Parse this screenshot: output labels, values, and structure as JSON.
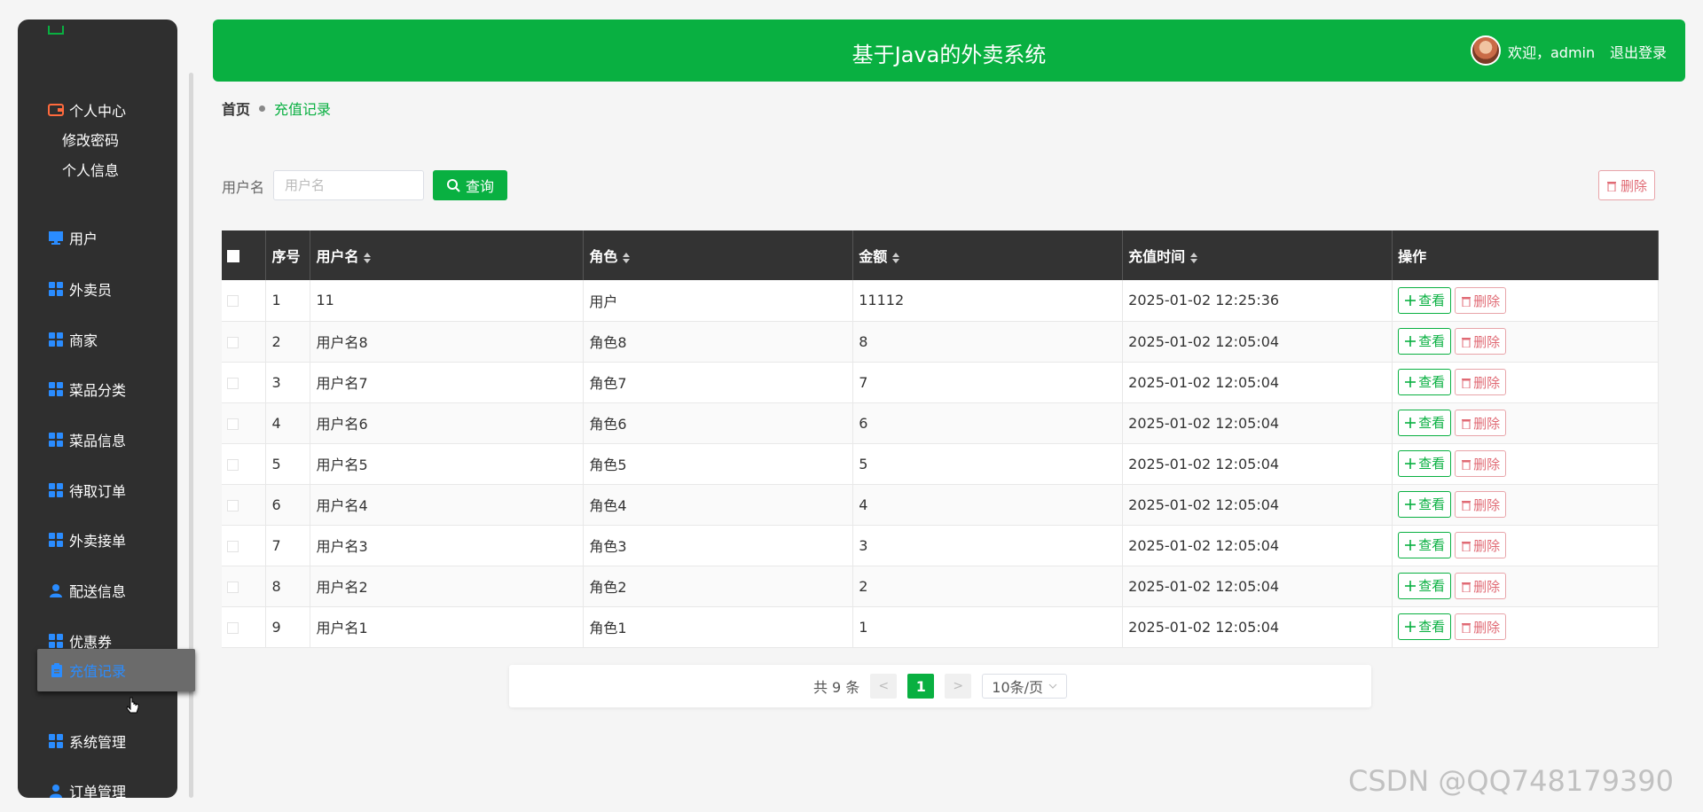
{
  "sidebar": {
    "cut_label": "",
    "personal_center": "个人中心",
    "sub_items": [
      "修改密码",
      "个人信息"
    ],
    "items": [
      {
        "label": "用户",
        "icon": "monitor-icon"
      },
      {
        "label": "外卖员",
        "icon": "grid-icon"
      },
      {
        "label": "商家",
        "icon": "grid-icon"
      },
      {
        "label": "菜品分类",
        "icon": "grid-icon"
      },
      {
        "label": "菜品信息",
        "icon": "grid-icon"
      },
      {
        "label": "待取订单",
        "icon": "grid-icon"
      },
      {
        "label": "外卖接单",
        "icon": "grid-icon"
      },
      {
        "label": "配送信息",
        "icon": "user-icon"
      },
      {
        "label": "优惠券",
        "icon": "grid-icon"
      },
      {
        "label": "充值记录",
        "icon": "clipboard-icon"
      },
      {
        "label": "系统管理",
        "icon": "grid-icon"
      },
      {
        "label": "订单管理",
        "icon": "user-icon"
      }
    ]
  },
  "header": {
    "title": "基于Java的外卖系统",
    "welcome": "欢迎，admin",
    "logout": "退出登录"
  },
  "breadcrumb": {
    "home": "首页",
    "current": "充值记录"
  },
  "search": {
    "label": "用户名",
    "placeholder": "用户名",
    "query_label": "查询",
    "delete_label": "删除"
  },
  "table": {
    "columns": [
      "序号",
      "用户名",
      "角色",
      "金额",
      "充值时间",
      "操作"
    ],
    "view_label": "查看",
    "delete_label": "删除",
    "rows": [
      [
        "1",
        "11",
        "用户",
        "11112",
        "2025-01-02 12:25:36"
      ],
      [
        "2",
        "用户名8",
        "角色8",
        "8",
        "2025-01-02 12:05:04"
      ],
      [
        "3",
        "用户名7",
        "角色7",
        "7",
        "2025-01-02 12:05:04"
      ],
      [
        "4",
        "用户名6",
        "角色6",
        "6",
        "2025-01-02 12:05:04"
      ],
      [
        "5",
        "用户名5",
        "角色5",
        "5",
        "2025-01-02 12:05:04"
      ],
      [
        "6",
        "用户名4",
        "角色4",
        "4",
        "2025-01-02 12:05:04"
      ],
      [
        "7",
        "用户名3",
        "角色3",
        "3",
        "2025-01-02 12:05:04"
      ],
      [
        "8",
        "用户名2",
        "角色2",
        "2",
        "2025-01-02 12:05:04"
      ],
      [
        "9",
        "用户名1",
        "角色1",
        "1",
        "2025-01-02 12:05:04"
      ]
    ]
  },
  "pagination": {
    "total": "共 9 条",
    "prev": "<",
    "current": "1",
    "next": ">",
    "page_size": "10条/页"
  },
  "watermark": "CSDN @QQ748179390",
  "colors": {
    "accent": "#09b041",
    "sidebar_bg": "#2f2f2f",
    "icon_blue": "#2a8cff",
    "danger": "#e06a74"
  }
}
